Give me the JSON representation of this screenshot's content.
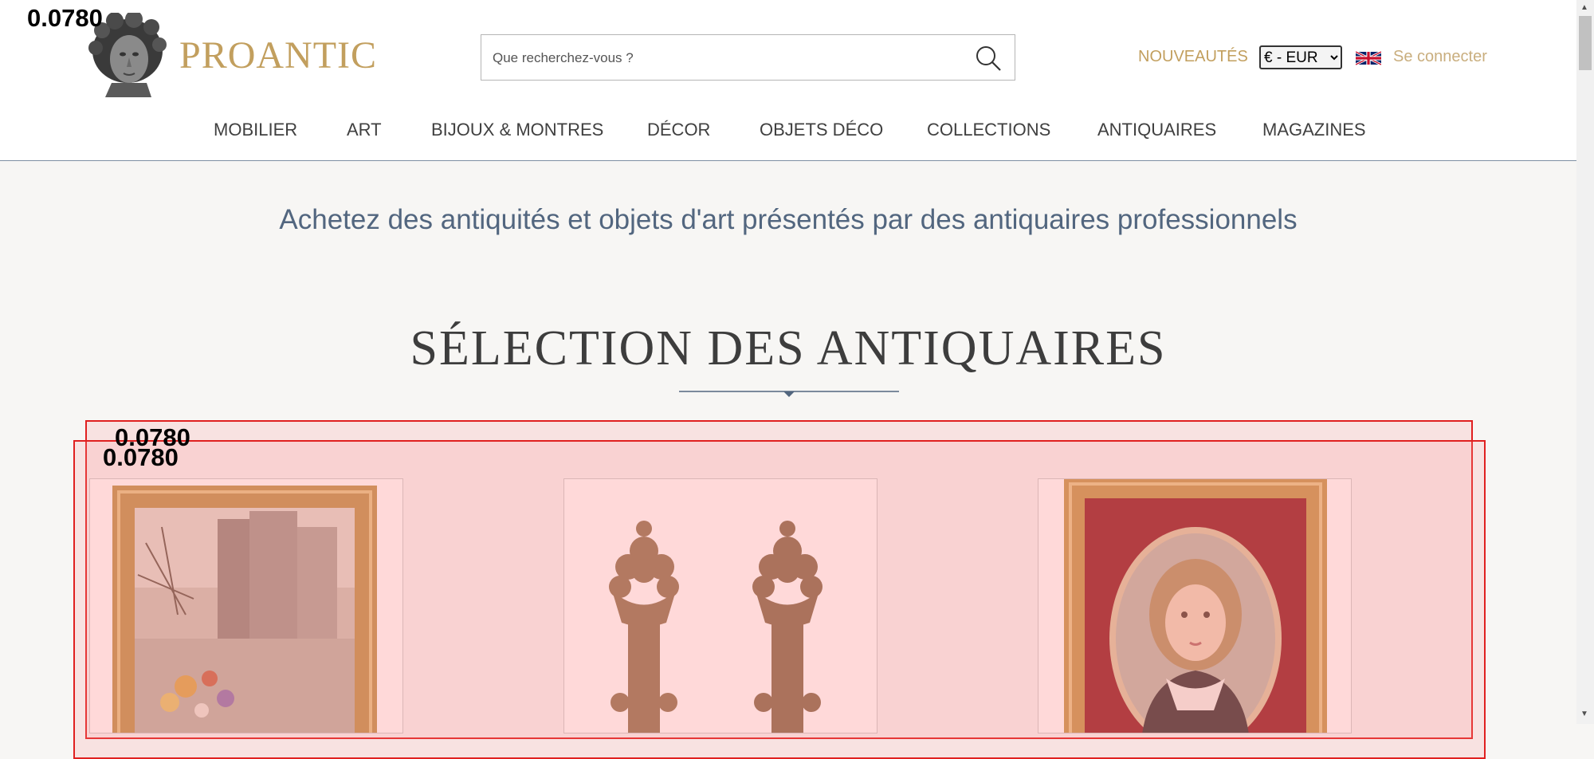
{
  "brand": {
    "name": "PROANTIC"
  },
  "search": {
    "placeholder": "Que recherchez-vous ?",
    "value": ""
  },
  "header_links": {
    "new_label": "NOUVEAUTÉS",
    "login_label": "Se connecter"
  },
  "currency": {
    "selected": "€ - EUR",
    "options": [
      "€ - EUR"
    ]
  },
  "nav": {
    "items": [
      {
        "label": "MOBILIER"
      },
      {
        "label": "ART"
      },
      {
        "label": "BIJOUX & MONTRES"
      },
      {
        "label": "DÉCOR"
      },
      {
        "label": "OBJETS DÉCO"
      },
      {
        "label": "COLLECTIONS"
      },
      {
        "label": "ANTIQUAIRES"
      },
      {
        "label": "MAGAZINES"
      }
    ]
  },
  "main": {
    "tagline": "Achetez des antiquités et objets d'art présentés par des antiquaires professionnels",
    "section_title": "SÉLECTION DES ANTIQUAIRES"
  },
  "overlay": {
    "scores": [
      "0.0780",
      "0.0780",
      "0.0780"
    ]
  },
  "products": [
    {
      "icon": "framed-city-painting-image"
    },
    {
      "icon": "pair-of-carved-finials-image"
    },
    {
      "icon": "framed-child-portrait-image"
    }
  ],
  "colors": {
    "brand_gold": "#c29f5e",
    "tagline_blue": "#52667f",
    "overlay_red": "#e02020"
  }
}
